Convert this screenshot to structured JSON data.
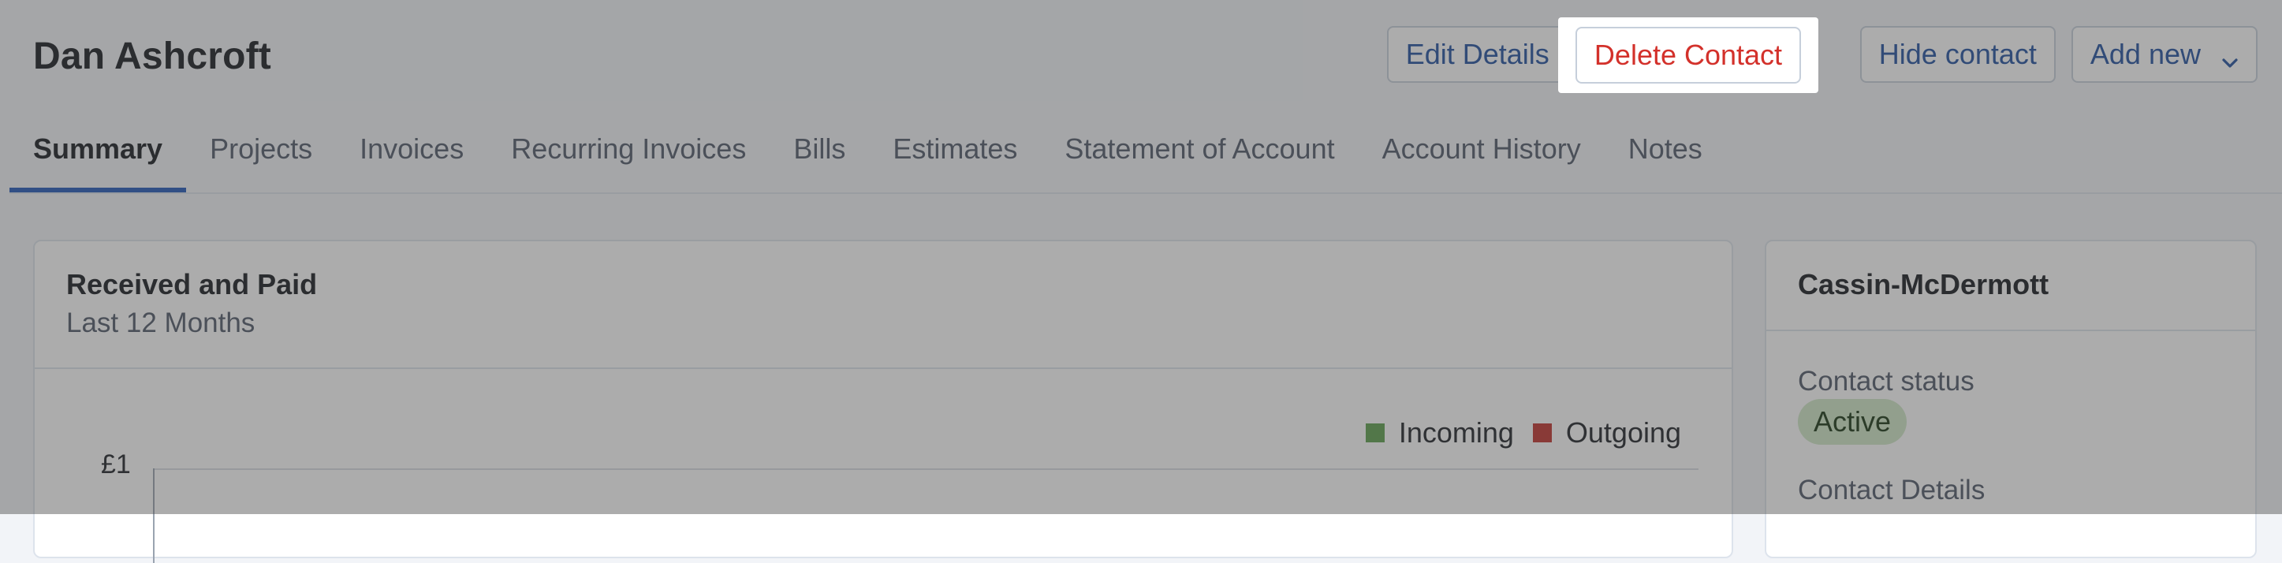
{
  "header": {
    "contact_name": "Dan Ashcroft",
    "buttons": {
      "edit": "Edit Details",
      "delete": "Delete Contact",
      "hide": "Hide contact",
      "add_new": "Add new"
    }
  },
  "tabs": [
    {
      "label": "Summary",
      "active": true
    },
    {
      "label": "Projects"
    },
    {
      "label": "Invoices"
    },
    {
      "label": "Recurring Invoices"
    },
    {
      "label": "Bills"
    },
    {
      "label": "Estimates"
    },
    {
      "label": "Statement of Account"
    },
    {
      "label": "Account History"
    },
    {
      "label": "Notes"
    }
  ],
  "chart_card": {
    "title": "Received and Paid",
    "subtitle": "Last 12 Months",
    "legend": [
      {
        "label": "Incoming",
        "color": "#5c9e4c"
      },
      {
        "label": "Outgoing",
        "color": "#c0302a"
      }
    ]
  },
  "chart_data": {
    "type": "bar",
    "title": "Received and Paid",
    "subtitle": "Last 12 Months",
    "series": [
      {
        "name": "Incoming",
        "values": []
      },
      {
        "name": "Outgoing",
        "values": []
      }
    ],
    "y_ticks": [
      "£1"
    ],
    "legend_position": "top-right"
  },
  "side_card": {
    "company": "Cassin-McDermott",
    "status_label": "Contact status",
    "status_value": "Active",
    "details_label": "Contact Details"
  },
  "colors": {
    "link_blue": "#1f4f9e",
    "danger_red": "#d3312b",
    "active_tab_underline": "#1f57b8",
    "status_badge_bg": "#cfe8c7"
  }
}
